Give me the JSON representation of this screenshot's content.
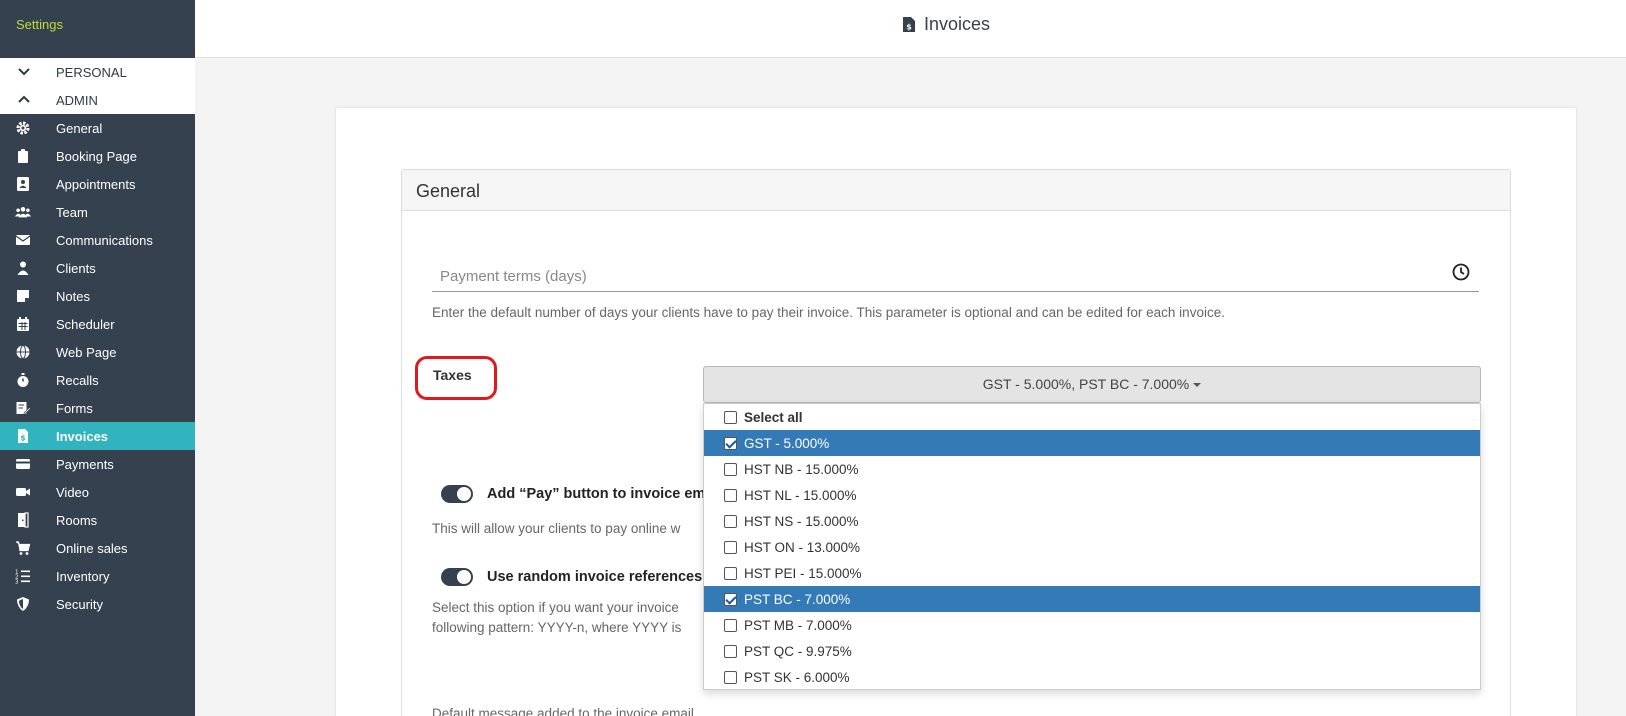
{
  "sidebar": {
    "title": "Settings",
    "sections": [
      {
        "label": "PERSONAL",
        "icon": "chevron-down-icon"
      },
      {
        "label": "ADMIN",
        "icon": "chevron-up-icon"
      }
    ],
    "items": [
      {
        "label": "General",
        "icon": "gear-icon"
      },
      {
        "label": " Booking Page",
        "icon": "clipboard-icon"
      },
      {
        "label": "Appointments",
        "icon": "contact-card-icon"
      },
      {
        "label": "Team",
        "icon": "users-icon"
      },
      {
        "label": "Communications",
        "icon": "envelope-icon"
      },
      {
        "label": "Clients",
        "icon": "user-icon"
      },
      {
        "label": "Notes",
        "icon": "sticky-note-icon"
      },
      {
        "label": "Scheduler",
        "icon": "calendar-icon"
      },
      {
        "label": " Web Page",
        "icon": "globe-icon"
      },
      {
        "label": "Recalls",
        "icon": "stopwatch-icon"
      },
      {
        "label": "Forms",
        "icon": "form-edit-icon"
      },
      {
        "label": "Invoices",
        "icon": "invoice-icon",
        "active": true
      },
      {
        "label": "Payments",
        "icon": "credit-card-icon"
      },
      {
        "label": "Video",
        "icon": "video-camera-icon"
      },
      {
        "label": "Rooms",
        "icon": "door-icon"
      },
      {
        "label": "Online sales",
        "icon": "shopping-cart-icon"
      },
      {
        "label": "Inventory",
        "icon": "list-icon"
      },
      {
        "label": "Security",
        "icon": "shield-icon"
      }
    ]
  },
  "header": {
    "title": "Invoices",
    "icon": "invoice-icon"
  },
  "panel": {
    "title": "General"
  },
  "payment_terms": {
    "placeholder": "Payment terms (days)",
    "value": "",
    "help": "Enter the default number of days your clients have to pay their invoice. This parameter is optional and can be edited for each invoice."
  },
  "taxes": {
    "label": "Taxes",
    "selected_text": "GST - 5.000%, PST BC - 7.000%",
    "options": [
      {
        "label": "Select all",
        "checked": false,
        "bold": true
      },
      {
        "label": "GST - 5.000%",
        "checked": true
      },
      {
        "label": "HST NB - 15.000%",
        "checked": false
      },
      {
        "label": "HST NL - 15.000%",
        "checked": false
      },
      {
        "label": "HST NS - 15.000%",
        "checked": false
      },
      {
        "label": "HST ON - 13.000%",
        "checked": false
      },
      {
        "label": "HST PEI - 15.000%",
        "checked": false
      },
      {
        "label": "PST BC - 7.000%",
        "checked": true
      },
      {
        "label": "PST MB - 7.000%",
        "checked": false
      },
      {
        "label": "PST QC - 9.975%",
        "checked": false
      },
      {
        "label": "PST SK - 6.000%",
        "checked": false
      }
    ]
  },
  "pay_button_toggle": {
    "label": "Add “Pay” button to invoice em",
    "on": true,
    "help": "This will allow your clients to pay online w"
  },
  "random_refs_toggle": {
    "label": "Use random invoice references",
    "on": true,
    "help_line1": "Select this option if you want your invoice",
    "help_line2": "following pattern: YYYY-n, where YYYY is"
  },
  "partial_bottom_text": "Default message added to the invoice email",
  "colors": {
    "sidebar_bg": "#35414f",
    "active_item_bg": "#31b4bd",
    "settings_title": "#c5d83a",
    "selected_option_bg": "#337ab7",
    "annotation_red": "#e0191f"
  }
}
